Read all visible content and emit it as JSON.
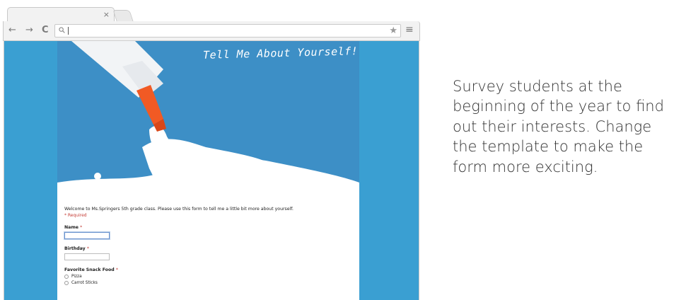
{
  "browser": {
    "tab_close_glyph": "×",
    "nav": {
      "back": "←",
      "forward": "→",
      "reload": "C"
    },
    "address": {
      "value": "",
      "placeholder": ""
    },
    "bookmark_glyph": "★",
    "menu_glyph": "≡"
  },
  "page": {
    "background_color": "#3a9fd2",
    "header_title": "Tell Me About Yourself!",
    "intro": "Welcome to Ms.Springers 5th grade class. Please use this form to tell me a little bit more about yourself.",
    "required_note": "* Required",
    "questions": [
      {
        "label": "Name",
        "required_mark": "*",
        "type": "text"
      },
      {
        "label": "Birthday",
        "required_mark": "*",
        "type": "text"
      },
      {
        "label": "Favorite Snack Food",
        "required_mark": "*",
        "type": "radio",
        "options": [
          "Pizza",
          "Carrot Sticks"
        ]
      }
    ]
  },
  "blurb": "Survey students at the beginning of the year to find out their interests. Change the template to make the form more exciting."
}
